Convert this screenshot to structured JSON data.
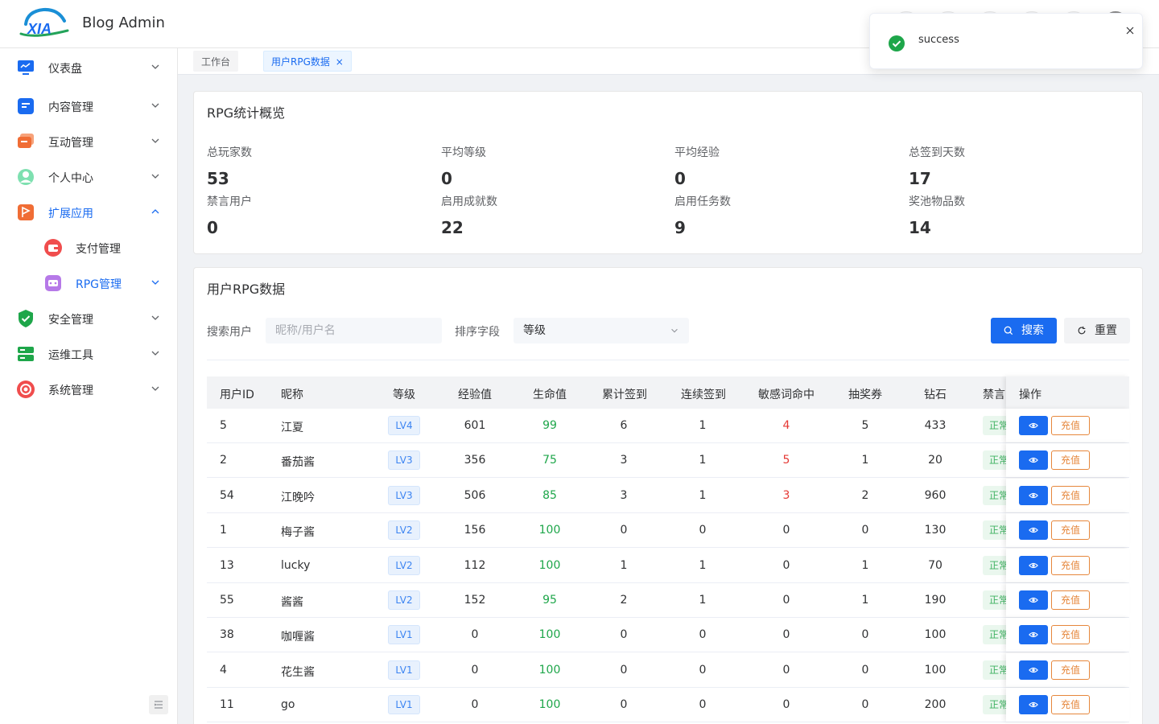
{
  "app": {
    "title": "Blog Admin",
    "logo_text": "XIA"
  },
  "sidebar": {
    "items": [
      {
        "key": "dashboard",
        "label": "仪表盘",
        "icon": "monitor-icon"
      },
      {
        "key": "content",
        "label": "内容管理",
        "icon": "document-icon"
      },
      {
        "key": "interaction",
        "label": "互动管理",
        "icon": "chat-icon"
      },
      {
        "key": "personal",
        "label": "个人中心",
        "icon": "user-icon"
      },
      {
        "key": "extension",
        "label": "扩展应用",
        "icon": "flag-icon"
      },
      {
        "key": "payment",
        "label": "支付管理",
        "icon": "wallet-icon"
      },
      {
        "key": "rpg",
        "label": "RPG管理",
        "icon": "game-icon"
      },
      {
        "key": "security",
        "label": "安全管理",
        "icon": "shield-icon"
      },
      {
        "key": "ops",
        "label": "运维工具",
        "icon": "tools-icon"
      },
      {
        "key": "system",
        "label": "系统管理",
        "icon": "settings-icon"
      }
    ]
  },
  "tags": {
    "workbench": "工作台",
    "current": "用户RPG数据"
  },
  "overview": {
    "title": "RPG统计概览",
    "stats": [
      {
        "label": "总玩家数",
        "value": "53"
      },
      {
        "label": "平均等级",
        "value": "0"
      },
      {
        "label": "平均经验",
        "value": "0"
      },
      {
        "label": "总签到天数",
        "value": "17"
      },
      {
        "label": "禁言用户",
        "value": "0"
      },
      {
        "label": "启用成就数",
        "value": "22"
      },
      {
        "label": "启用任务数",
        "value": "9"
      },
      {
        "label": "奖池物品数",
        "value": "14"
      }
    ]
  },
  "userdata": {
    "title": "用户RPG数据",
    "search_label": "搜索用户",
    "search_placeholder": "昵称/用户名",
    "sort_label": "排序字段",
    "sort_value": "等级",
    "search_btn": "搜索",
    "reset_btn": "重置"
  },
  "table": {
    "headers": [
      "用户ID",
      "昵称",
      "等级",
      "经验值",
      "生命值",
      "累计签到",
      "连续签到",
      "敏感词命中",
      "抽奖券",
      "钻石",
      "禁言",
      "操作"
    ],
    "status_text": "正常",
    "charge_label": "充值",
    "rows": [
      {
        "id": "5",
        "nick": "江夏",
        "level": "LV4",
        "exp": "601",
        "hp": "99",
        "total": "6",
        "streak": "1",
        "hits": "4",
        "tickets": "5",
        "diamond": "433"
      },
      {
        "id": "2",
        "nick": "番茄酱",
        "level": "LV3",
        "exp": "356",
        "hp": "75",
        "total": "3",
        "streak": "1",
        "hits": "5",
        "tickets": "1",
        "diamond": "20"
      },
      {
        "id": "54",
        "nick": "江晚吟",
        "level": "LV3",
        "exp": "506",
        "hp": "85",
        "total": "3",
        "streak": "1",
        "hits": "3",
        "tickets": "2",
        "diamond": "960"
      },
      {
        "id": "1",
        "nick": "梅子酱",
        "level": "LV2",
        "exp": "156",
        "hp": "100",
        "total": "0",
        "streak": "0",
        "hits": "0",
        "tickets": "0",
        "diamond": "130"
      },
      {
        "id": "13",
        "nick": "lucky",
        "level": "LV2",
        "exp": "112",
        "hp": "100",
        "total": "1",
        "streak": "1",
        "hits": "0",
        "tickets": "1",
        "diamond": "70"
      },
      {
        "id": "55",
        "nick": "酱酱",
        "level": "LV2",
        "exp": "152",
        "hp": "95",
        "total": "2",
        "streak": "1",
        "hits": "0",
        "tickets": "1",
        "diamond": "190"
      },
      {
        "id": "38",
        "nick": "咖喱酱",
        "level": "LV1",
        "exp": "0",
        "hp": "100",
        "total": "0",
        "streak": "0",
        "hits": "0",
        "tickets": "0",
        "diamond": "100"
      },
      {
        "id": "4",
        "nick": "花生酱",
        "level": "LV1",
        "exp": "0",
        "hp": "100",
        "total": "0",
        "streak": "0",
        "hits": "0",
        "tickets": "0",
        "diamond": "100"
      },
      {
        "id": "11",
        "nick": "go",
        "level": "LV1",
        "exp": "0",
        "hp": "100",
        "total": "0",
        "streak": "0",
        "hits": "0",
        "tickets": "0",
        "diamond": "200"
      }
    ]
  },
  "toast": {
    "message": "success"
  },
  "colors": {
    "primary": "#1a6bf0",
    "success": "#1ea64a",
    "danger": "#e53935",
    "warning": "#e6873c"
  }
}
